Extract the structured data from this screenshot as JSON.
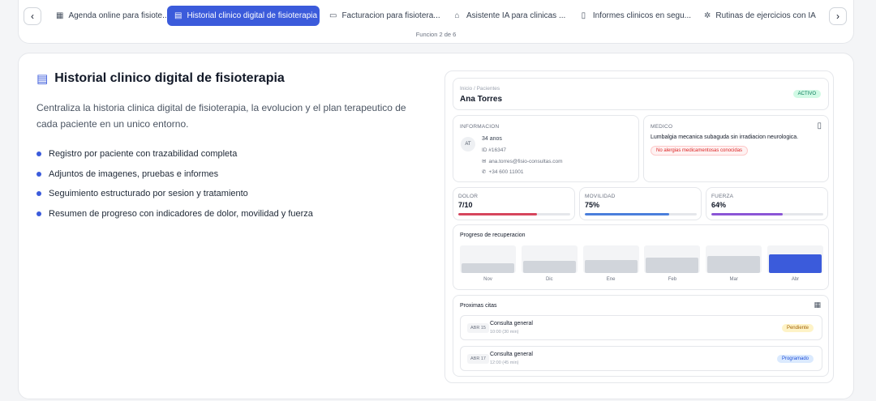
{
  "tabs": [
    {
      "label": "Agenda online para fisiote...",
      "icon": "calendar-icon",
      "glyph": "▦"
    },
    {
      "label": "Historial clinico digital de fisioterapia",
      "icon": "clipboard-icon",
      "glyph": "▤"
    },
    {
      "label": "Facturacion para fisiotera...",
      "icon": "credit-card-icon",
      "glyph": "▭"
    },
    {
      "label": "Asistente IA para clinicas ...",
      "icon": "robot-icon",
      "glyph": "⌂"
    },
    {
      "label": "Informes clinicos en segu...",
      "icon": "document-icon",
      "glyph": "▯"
    },
    {
      "label": "Rutinas de ejercicios con IA",
      "icon": "sparkle-icon",
      "glyph": "✲"
    }
  ],
  "step_counter": "Funcion 2 de 6",
  "feature": {
    "title": "Historial clinico digital de fisioterapia",
    "description": "Centraliza la historia clinica digital de fisioterapia, la evolucion y el plan terapeutico de cada paciente en un unico entorno.",
    "bullets": [
      "Registro por paciente con trazabilidad completa",
      "Adjuntos de imagenes, pruebas e informes",
      "Seguimiento estructurado por sesion y tratamiento",
      "Resumen de progreso con indicadores de dolor, movilidad y fuerza"
    ]
  },
  "patient": {
    "breadcrumb": "Inicio / Pacientes",
    "name": "Ana Torres",
    "status": "ACTIVO",
    "info_label": "INFORMACION",
    "initials": "AT",
    "age": "34 anos",
    "id": "ID #16347",
    "email": "ana.torres@fisio-consultas.com",
    "phone": "+34 600 11001"
  },
  "medical": {
    "label": "MEDICO",
    "diagnosis": "Lumbalgia mecanica subaguda sin irradiacion neurologica.",
    "allergy": "No alergias medicamentosas conocidas"
  },
  "metrics": [
    {
      "label": "DOLOR",
      "value": "7/10",
      "percent": 70,
      "color": "#d6455d"
    },
    {
      "label": "MOVILIDAD",
      "value": "75%",
      "percent": 75,
      "color": "#4a7fdc"
    },
    {
      "label": "FUERZA",
      "value": "64%",
      "percent": 64,
      "color": "#8b55d6"
    }
  ],
  "recovery": {
    "title": "Progreso de recuperacion",
    "months": [
      {
        "label": "Nov",
        "level": 35
      },
      {
        "label": "Dic",
        "level": 44
      },
      {
        "label": "Ene",
        "level": 48
      },
      {
        "label": "Feb",
        "level": 56
      },
      {
        "label": "Mar",
        "level": 62
      },
      {
        "label": "Abr",
        "level": 68
      }
    ],
    "highlight_color": "#3b5bdb"
  },
  "appointments": {
    "title": "Proximas citas",
    "items": [
      {
        "date": "ABR 15",
        "type": "Consulta general",
        "time": "10:00 (30 min)",
        "status": "Pendiente",
        "status_kind": "pending"
      },
      {
        "date": "ABR 17",
        "type": "Consulta general",
        "time": "12:00 (45 min)",
        "status": "Programado",
        "status_kind": "scheduled"
      }
    ]
  }
}
